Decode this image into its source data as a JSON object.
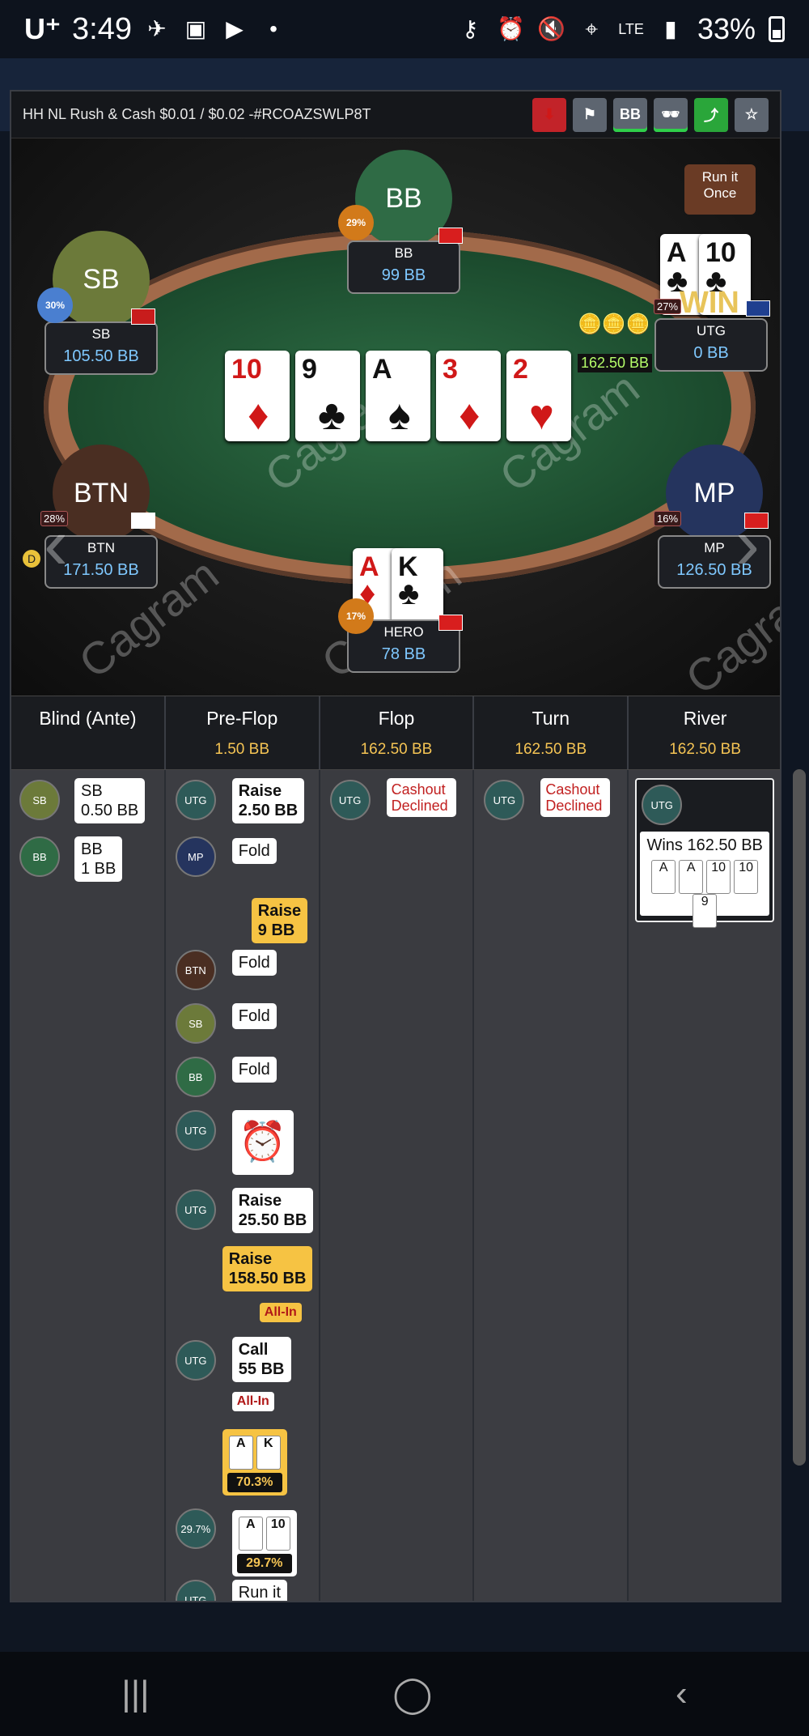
{
  "statusbar": {
    "carrier": "U⁺",
    "time": "3:49",
    "lte": "LTE",
    "battery": "33%"
  },
  "header": {
    "title": "HH NL Rush & Cash $0.01 / $0.02 -#RCOAZSWLP8T",
    "bb_button": "BB"
  },
  "table": {
    "pot": "162.50 BB",
    "run_it_once": "Run it Once",
    "win": "WIN",
    "watermark": "Cagram",
    "board": [
      {
        "rank": "10",
        "suit": "♦",
        "color": "#d01818"
      },
      {
        "rank": "9",
        "suit": "♣",
        "color": "#111111"
      },
      {
        "rank": "A",
        "suit": "♠",
        "color": "#111111"
      },
      {
        "rank": "3",
        "suit": "♦",
        "color": "#d01818"
      },
      {
        "rank": "2",
        "suit": "♥",
        "color": "#d01818"
      }
    ],
    "seats": {
      "bb": {
        "avatar": "BB",
        "name": "BB",
        "stack": "99 BB",
        "pct": "29%"
      },
      "sb": {
        "avatar": "SB",
        "name": "SB",
        "stack": "105.50 BB",
        "pct": "30%"
      },
      "utg": {
        "name": "UTG",
        "stack": "0 BB",
        "pct": "27%",
        "card1": "A",
        "card2": "10"
      },
      "btn": {
        "avatar": "BTN",
        "name": "BTN",
        "stack": "171.50 BB",
        "pct": "28%"
      },
      "mp": {
        "avatar": "MP",
        "name": "MP",
        "stack": "126.50 BB",
        "pct": "16%"
      },
      "hero": {
        "name": "HERO",
        "stack": "78 BB",
        "pct": "17%",
        "card1": "A",
        "card2": "K"
      }
    }
  },
  "streets": [
    {
      "name": "Blind (Ante)",
      "pot": ""
    },
    {
      "name": "Pre-Flop",
      "pot": "1.50 BB"
    },
    {
      "name": "Flop",
      "pot": "162.50 BB"
    },
    {
      "name": "Turn",
      "pot": "162.50 BB"
    },
    {
      "name": "River",
      "pot": "162.50 BB"
    }
  ],
  "actions": {
    "blind": [
      {
        "pos": "SB",
        "line1": "SB",
        "line2": "0.50 BB"
      },
      {
        "pos": "BB",
        "line1": "BB",
        "line2": "1 BB"
      }
    ],
    "preflop": {
      "utg_raise1": [
        "UTG",
        "Raise",
        "2.50 BB"
      ],
      "mp_fold": [
        "MP",
        "Fold"
      ],
      "hero_raise1": [
        "Raise",
        "9 BB"
      ],
      "btn_fold": [
        "BTN",
        "Fold"
      ],
      "sb_fold": [
        "SB",
        "Fold"
      ],
      "bb_fold": [
        "BB",
        "Fold"
      ],
      "utg_timer": "UTG",
      "utg_raise2": [
        "UTG",
        "Raise",
        "25.50 BB"
      ],
      "hero_raise2": [
        "Raise",
        "158.50 BB"
      ],
      "hero_allin": "All-In",
      "utg_call": [
        "UTG",
        "Call",
        "55 BB"
      ],
      "utg_allin": "All-In",
      "hero_equity": "70.3%",
      "hero_cards": [
        "A",
        "K"
      ],
      "utg_equity": "29.7%",
      "utg_cards": [
        "A",
        "10"
      ],
      "utg_runit": [
        "UTG",
        "Run it"
      ]
    },
    "flop": {
      "pos": "UTG",
      "text": "Cashout Declined"
    },
    "turn": {
      "pos": "UTG",
      "text": "Cashout Declined"
    },
    "river": {
      "pos": "UTG",
      "text": "Wins 162.50 BB",
      "cards": [
        "A",
        "A",
        "10",
        "10",
        "9"
      ]
    }
  },
  "colors": {
    "accent_red": "#c22329",
    "accent_green": "#2aa63a",
    "raise_yellow": "#f6c343",
    "pot_yellow": "#f5c454"
  }
}
